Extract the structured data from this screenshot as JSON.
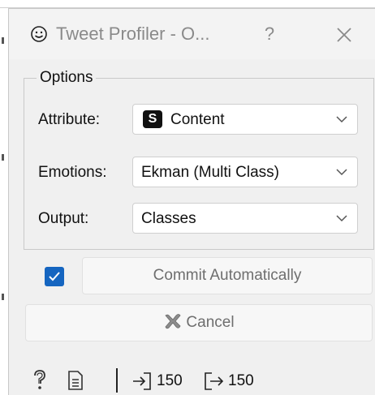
{
  "dialog": {
    "title": "Tweet Profiler - O...",
    "help_label": "?",
    "options_group_title": "Options",
    "fields": [
      {
        "label": "Attribute:",
        "value": "Content",
        "badge": "S"
      },
      {
        "label": "Emotions:",
        "value": "Ekman (Multi Class)"
      },
      {
        "label": "Output:",
        "value": "Classes"
      }
    ],
    "commit_checked": true,
    "commit_label": "Commit Automatically",
    "cancel_label": "Cancel"
  },
  "status": {
    "input_count": "150",
    "output_count": "150"
  },
  "colors": {
    "accent": "#1565c0",
    "title_text": "#8a8a8a",
    "disabled_text": "#6e6e6e"
  },
  "icons": {
    "app": "smiley-icon",
    "close": "close-icon",
    "cancel": "cancel-x-icon",
    "help": "help-icon",
    "report": "report-icon",
    "input": "input-arrow-icon",
    "output": "output-arrow-icon"
  }
}
